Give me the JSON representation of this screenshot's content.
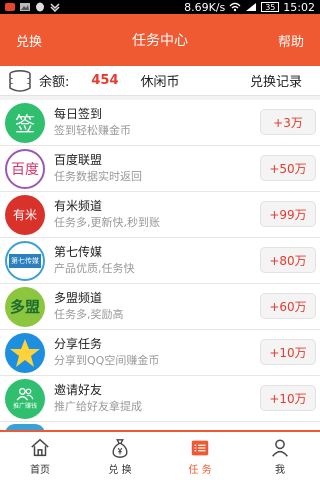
{
  "status_bar": {
    "speed": "8.69K/s",
    "battery": "35",
    "time": "15:02"
  },
  "header": {
    "left_label": "兑换",
    "title": "任务中心",
    "right_label": "帮助"
  },
  "balance": {
    "label": "余额:",
    "value": "454",
    "unit": "休闲币",
    "link": "兑换记录"
  },
  "tasks": [
    {
      "name": "每日签到",
      "desc": "签到轻松赚金币",
      "reward": "+3万",
      "logo_text": "签",
      "logo_color": "#2fbf6f"
    },
    {
      "name": "百度联盟",
      "desc": "任务数据实时返回",
      "reward": "+50万",
      "logo_text": "百度",
      "logo_color": "#ffffff"
    },
    {
      "name": "有米频道",
      "desc": "任务多,更新快,秒到账",
      "reward": "+99万",
      "logo_text": "有米",
      "logo_color": "#d9322a"
    },
    {
      "name": "第七传媒",
      "desc": "产品优质,任务快",
      "reward": "+80万",
      "logo_text": "第七传媒",
      "logo_color": "#ffffff"
    },
    {
      "name": "多盟频道",
      "desc": "任务多,奖励高",
      "reward": "+60万",
      "logo_text": "多盟",
      "logo_color": "#8cc63f"
    },
    {
      "name": "分享任务",
      "desc": "分享到QQ空间赚金币",
      "reward": "+10万",
      "logo_text": "",
      "logo_color": "#1d8ee0"
    },
    {
      "name": "邀请好友",
      "desc": "推广给好友拿提成",
      "reward": "+10万",
      "logo_text": "推广赚钱",
      "logo_color": "#2fbf6f"
    }
  ],
  "tabs": [
    {
      "label": "首页",
      "icon": "home-icon"
    },
    {
      "label": "兑 换",
      "icon": "money-bag-icon"
    },
    {
      "label": "任 务",
      "icon": "task-list-icon"
    },
    {
      "label": "我",
      "icon": "user-icon"
    }
  ],
  "colors": {
    "accent": "#ef5a32",
    "reward": "#e63a2e"
  }
}
